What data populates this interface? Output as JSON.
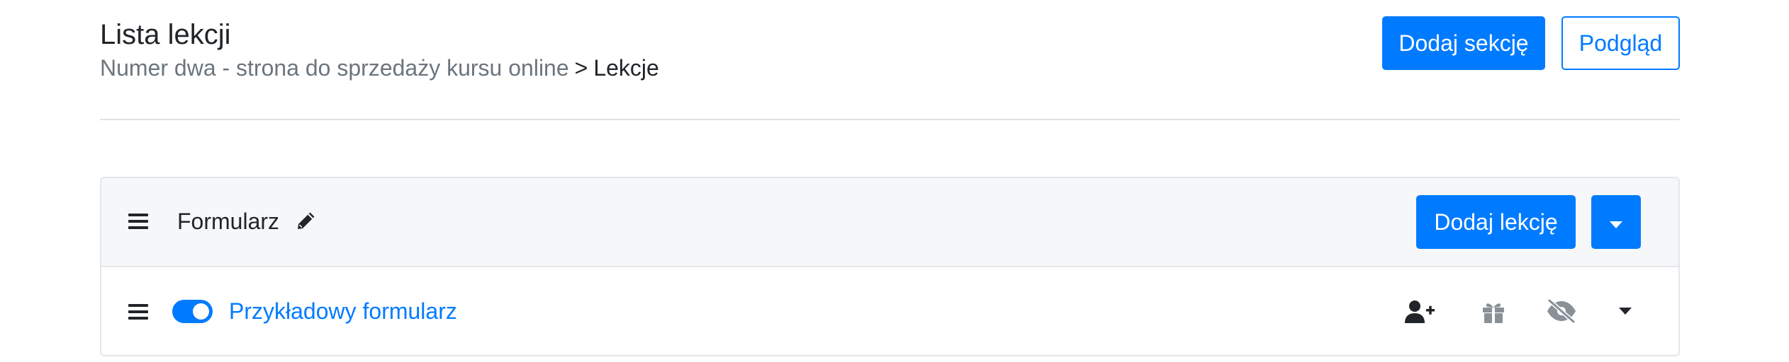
{
  "header": {
    "title": "Lista lekcji",
    "breadcrumb": {
      "course": "Numer dwa - strona do sprzedaży kursu online",
      "separator": ">",
      "current": "Lekcje"
    },
    "add_section_label": "Dodaj sekcję",
    "preview_label": "Podgląd"
  },
  "section": {
    "name": "Formularz",
    "add_lesson_label": "Dodaj lekcję",
    "lessons": [
      {
        "title": "Przykładowy formularz",
        "published": true
      }
    ]
  },
  "icons": {
    "section_drag": "bars-icon",
    "section_edit": "pencil-icon",
    "section_dropdown": "caret-down-icon",
    "lesson_drag": "bars-icon",
    "lesson_assign": "user-plus-icon",
    "lesson_gift": "gift-icon",
    "lesson_hide": "eye-slash-icon",
    "lesson_more": "caret-down-icon"
  },
  "colors": {
    "primary": "#007bff",
    "text": "#212529",
    "muted": "#6c757d",
    "icon_muted": "#8a9098",
    "card_header_bg": "#f6f7f8"
  }
}
